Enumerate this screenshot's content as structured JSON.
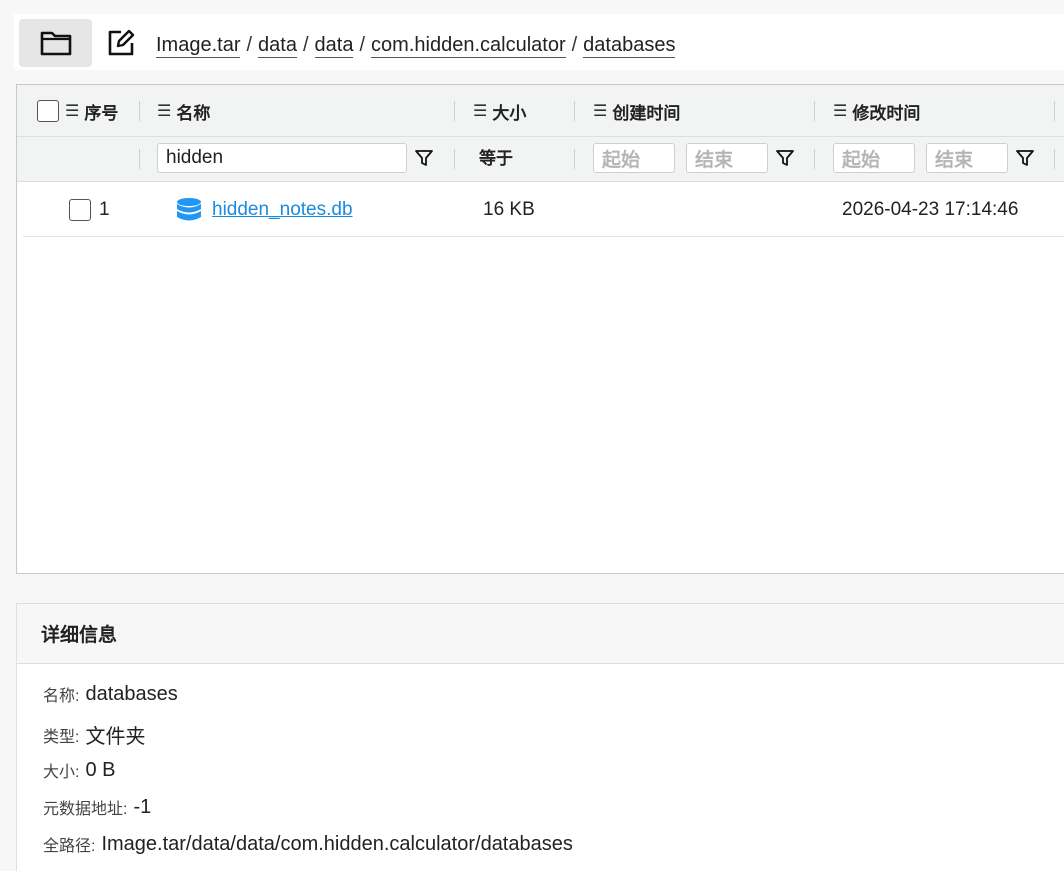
{
  "toolbar": {
    "folder_icon": "folder-icon",
    "edit_icon": "edit-icon"
  },
  "breadcrumb": [
    "Image.tar",
    "data",
    "data",
    "com.hidden.calculator",
    "databases"
  ],
  "breadcrumb_separator": "/",
  "table": {
    "columns": {
      "index": "序号",
      "name": "名称",
      "size": "大小",
      "created": "创建时间",
      "modified": "修改时间"
    },
    "filters": {
      "name_value": "hidden",
      "size_mode": "等于",
      "created_start_placeholder": "起始",
      "created_end_placeholder": "结束",
      "modified_start_placeholder": "起始",
      "modified_end_placeholder": "结束"
    },
    "rows": [
      {
        "index": "1",
        "name": "hidden_notes.db",
        "icon": "database-icon",
        "size": "16 KB",
        "created": "",
        "modified": "2026-04-23 17:14:46"
      }
    ]
  },
  "details": {
    "title": "详细信息",
    "fields": [
      {
        "label": "名称:",
        "value": "databases"
      },
      {
        "label": "类型:",
        "value": "文件夹"
      },
      {
        "label": "大小:",
        "value": "0 B"
      },
      {
        "label": "元数据地址:",
        "value": "-1"
      },
      {
        "label": "全路径:",
        "value": "Image.tar/data/data/com.hidden.calculator/databases"
      }
    ]
  },
  "colors": {
    "link": "#1a8ce0",
    "db_icon": "#2196f3",
    "header_bg": "#f2f3f3"
  }
}
